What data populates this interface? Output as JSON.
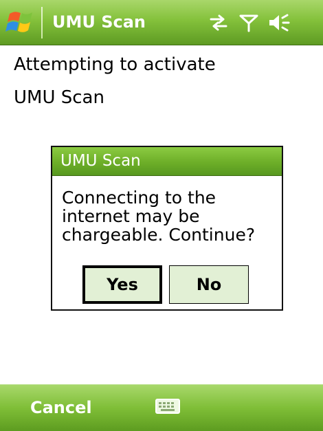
{
  "title_bar": {
    "app_title": "UMU Scan",
    "status_icons": [
      "connectivity-icon",
      "signal-icon",
      "volume-icon"
    ]
  },
  "content": {
    "line1": "Attempting to activate",
    "line2": "UMU Scan"
  },
  "dialog": {
    "title": "UMU Scan",
    "message": "Connecting to the internet may be chargeable. Continue?",
    "yes_label": "Yes",
    "no_label": "No"
  },
  "menu_bar": {
    "left_softkey": "Cancel",
    "center_icon": "keyboard-icon"
  },
  "colors": {
    "accent_green": "#7fbe37",
    "button_fill": "#e2f0d5"
  }
}
